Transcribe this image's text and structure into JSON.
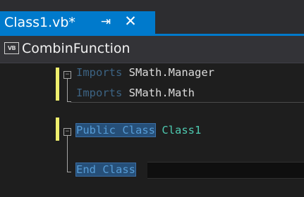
{
  "tab": {
    "title": "Class1.vb*",
    "pin_glyph": "⇥",
    "close_glyph": "✕"
  },
  "navbar": {
    "badge_text": "VB",
    "label": "CombinFunction"
  },
  "editor": {
    "lines": [
      {
        "keyword": "Imports",
        "identifier": "SMath.Manager"
      },
      {
        "keyword": "Imports",
        "identifier": "SMath.Math"
      },
      {
        "keyword": "Public Class",
        "class_name": "Class1"
      },
      {
        "keyword": "End Class"
      }
    ],
    "fold_glyph": "−"
  },
  "colors": {
    "accent": "#007acc",
    "keyword": "#569cd6",
    "type_name": "#4ec9b0",
    "change_bar": "#efef6e",
    "selection": "#264f78"
  }
}
